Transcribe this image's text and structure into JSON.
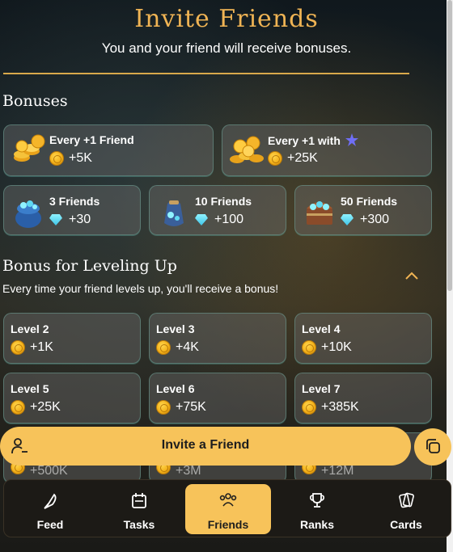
{
  "header": {
    "title": "Invite Friends",
    "subtitle": "You and your friend will receive bonuses."
  },
  "bonuses": {
    "title": "Bonuses",
    "cards": [
      {
        "name": "Every +1 Friend",
        "value": "+5K",
        "currency": "coin"
      },
      {
        "name": "Every +1 with",
        "value": "+25K",
        "currency": "coin",
        "badge_icon": "star-icon"
      },
      {
        "name": "3 Friends",
        "value": "+30",
        "currency": "gem"
      },
      {
        "name": "10 Friends",
        "value": "+100",
        "currency": "gem"
      },
      {
        "name": "50 Friends",
        "value": "+300",
        "currency": "gem"
      }
    ]
  },
  "leveling": {
    "title": "Bonus for Leveling Up",
    "description": "Every time your friend levels up, you'll receive a bonus!",
    "levels": [
      {
        "name": "Level 2",
        "value": "+1K"
      },
      {
        "name": "Level 3",
        "value": "+4K"
      },
      {
        "name": "Level 4",
        "value": "+10K"
      },
      {
        "name": "Level 5",
        "value": "+25K"
      },
      {
        "name": "Level 6",
        "value": "+75K"
      },
      {
        "name": "Level 7",
        "value": "+385K"
      }
    ],
    "partial_row": [
      "+500K",
      "+3M",
      "+12M"
    ]
  },
  "invite": {
    "label": "Invite a Friend",
    "user_icon": "user-icon",
    "copy_icon": "copy-icon"
  },
  "nav": {
    "items": [
      {
        "label": "Feed",
        "icon": "feather-icon"
      },
      {
        "label": "Tasks",
        "icon": "calendar-icon"
      },
      {
        "label": "Friends",
        "icon": "friends-icon",
        "active": true
      },
      {
        "label": "Ranks",
        "icon": "trophy-icon"
      },
      {
        "label": "Cards",
        "icon": "cards-icon"
      }
    ]
  },
  "colors": {
    "accent": "#f7c35a",
    "title_gold": "#f0b454",
    "gem": "#3fc5e8"
  }
}
